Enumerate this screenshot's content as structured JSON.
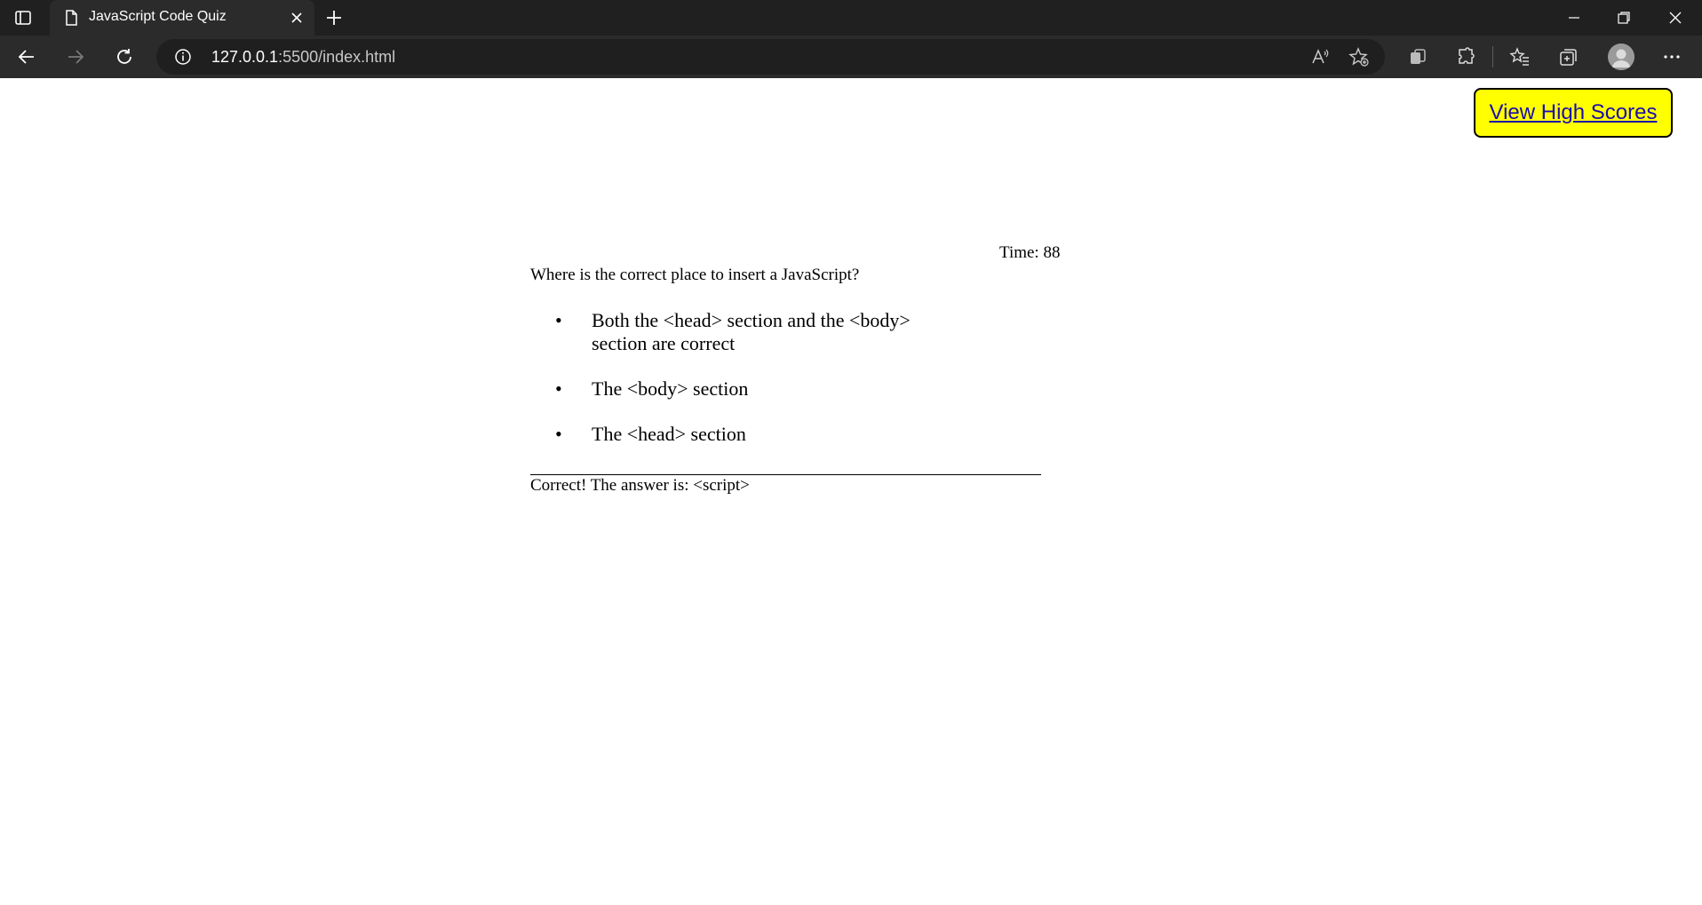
{
  "browser": {
    "tab_title": "JavaScript Code Quiz",
    "url_host": "127.0.0.1",
    "url_rest": ":5500/index.html",
    "icons": {
      "tab_actions": "tab-actions-icon",
      "favicon": "page-icon",
      "tab_close": "close-icon",
      "new_tab": "plus-icon",
      "minimize": "minimize-icon",
      "restore": "restore-icon",
      "close_window": "close-icon",
      "back": "back-arrow-icon",
      "forward": "forward-arrow-icon",
      "refresh": "refresh-icon",
      "site_info": "info-icon",
      "read_aloud": "read-aloud-icon",
      "add_favorite": "add-favorite-icon",
      "workspaces": "workspaces-icon",
      "extensions": "extensions-icon",
      "favorites": "favorites-icon",
      "collections": "collections-icon",
      "profile": "profile-avatar-icon",
      "more": "more-icon"
    }
  },
  "page": {
    "high_scores_label": "View High Scores",
    "high_scores_bg": "#ffff00",
    "timer_text": "Time: 88",
    "question": "Where is the correct place to insert a JavaScript?",
    "answers": [
      "Both the <head> section and the <body> section are correct",
      "The <body> section",
      "The <head> section"
    ],
    "result": "Correct! The answer is: <script>"
  }
}
